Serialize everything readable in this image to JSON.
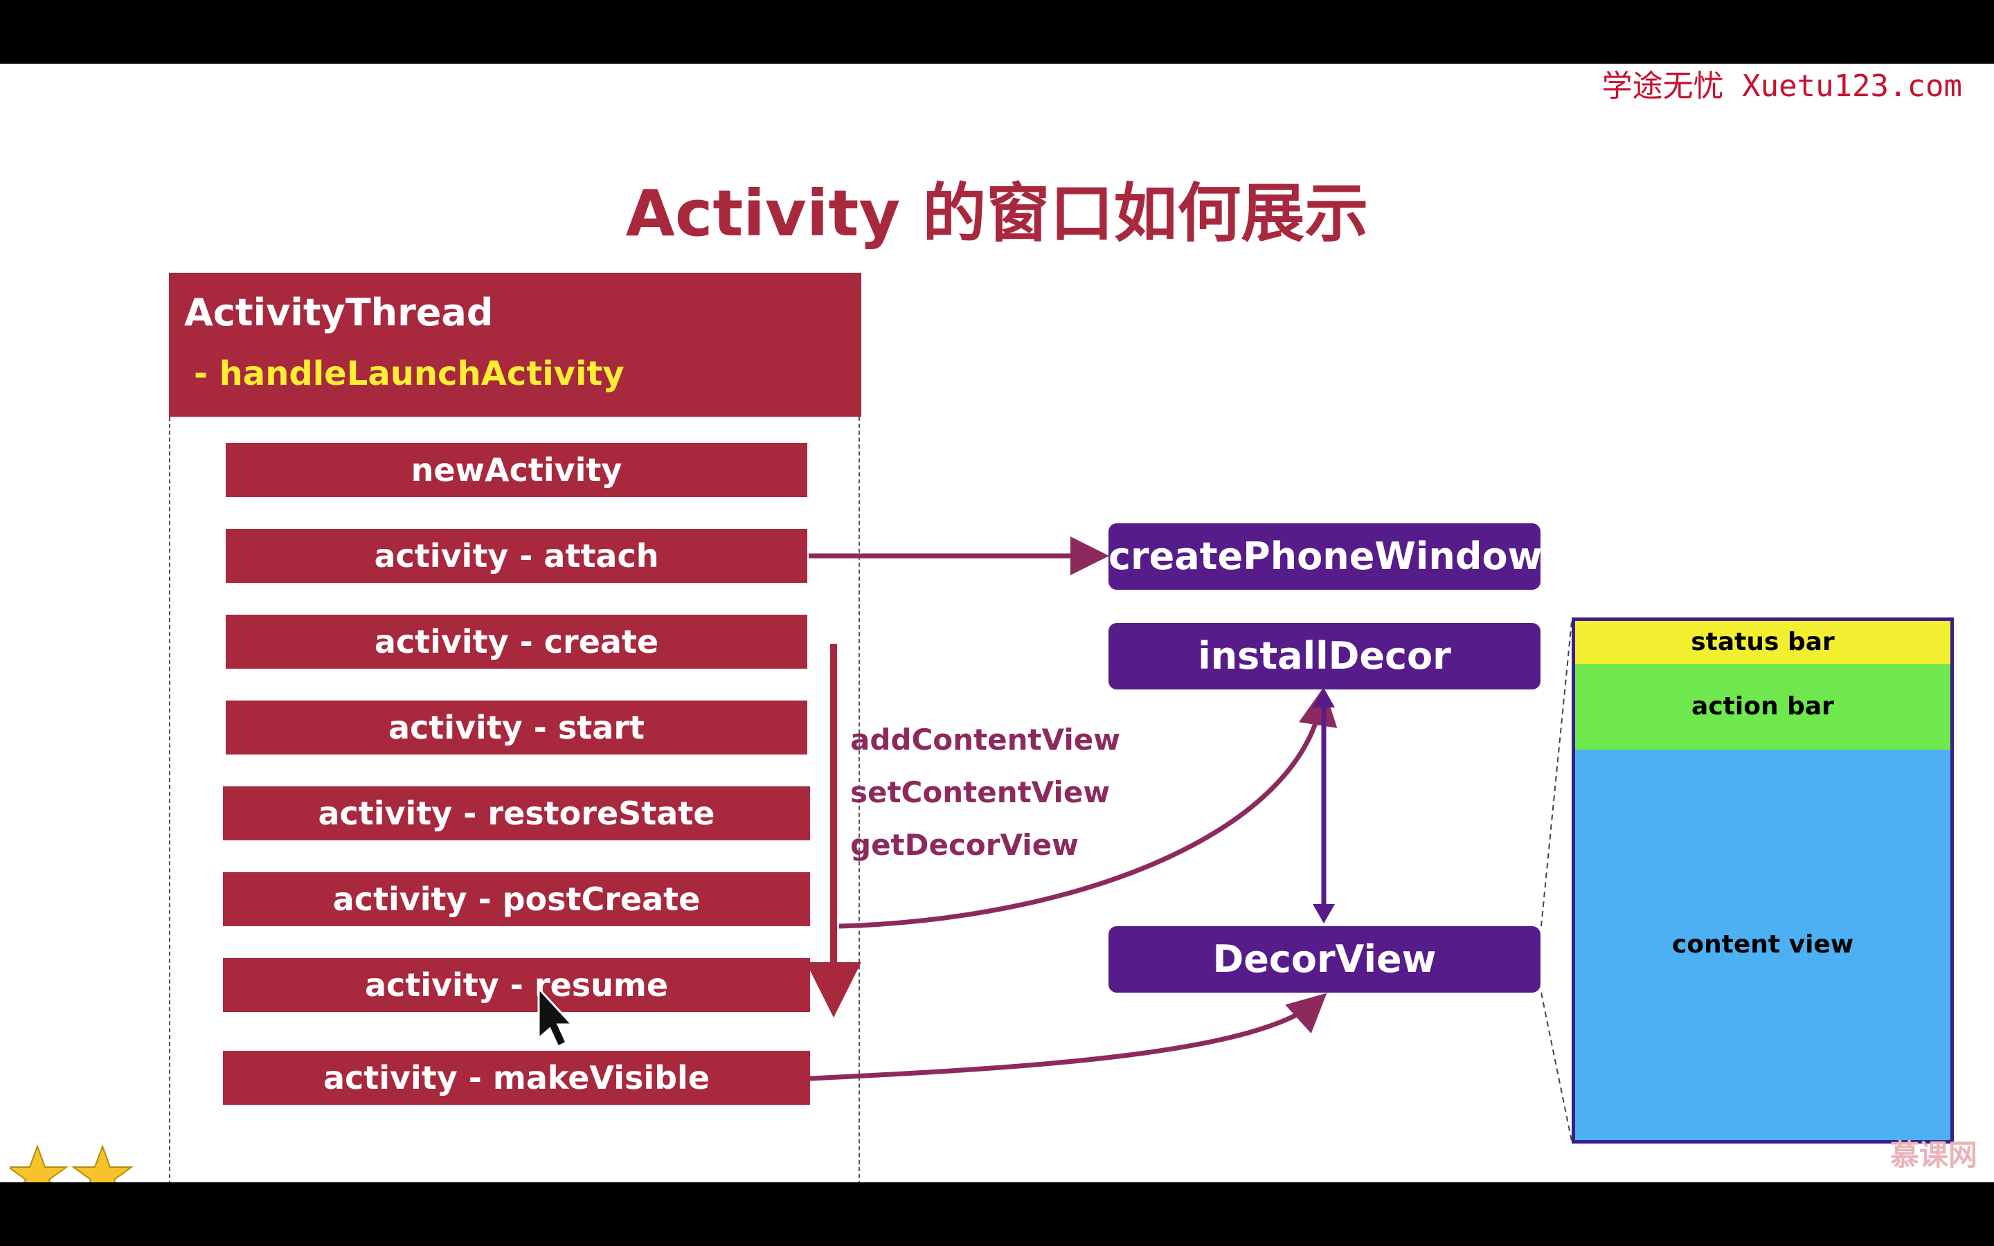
{
  "watermark": "学途无忧 Xuetu123.com",
  "title": "Activity 的窗口如何展示",
  "thread": {
    "name": "ActivityThread",
    "method": "- handleLaunchActivity"
  },
  "steps": [
    "newActivity",
    "activity - attach",
    "activity - create",
    "activity - start",
    "activity - restoreState",
    "activity - postCreate",
    "activity - resume",
    "activity - makeVisible"
  ],
  "window_components": {
    "create_phone_window": "createPhoneWindow",
    "install_decor": "installDecor",
    "decor_view": "DecorView"
  },
  "flow_labels": [
    "addContentView",
    "setContentView",
    "getDecorView"
  ],
  "window_layout": {
    "status_bar": "status bar",
    "action_bar": "action bar",
    "content_view": "content view"
  },
  "logo_text": "慕课网",
  "colors": {
    "step_red": "#a8283e",
    "box_purple": "#561c8a",
    "arrow_magenta": "#8c2a5e",
    "method_yellow": "#ffee33",
    "status_yellow": "#f2ee30",
    "action_green": "#6ee84c",
    "content_blue": "#4cb0f2"
  }
}
